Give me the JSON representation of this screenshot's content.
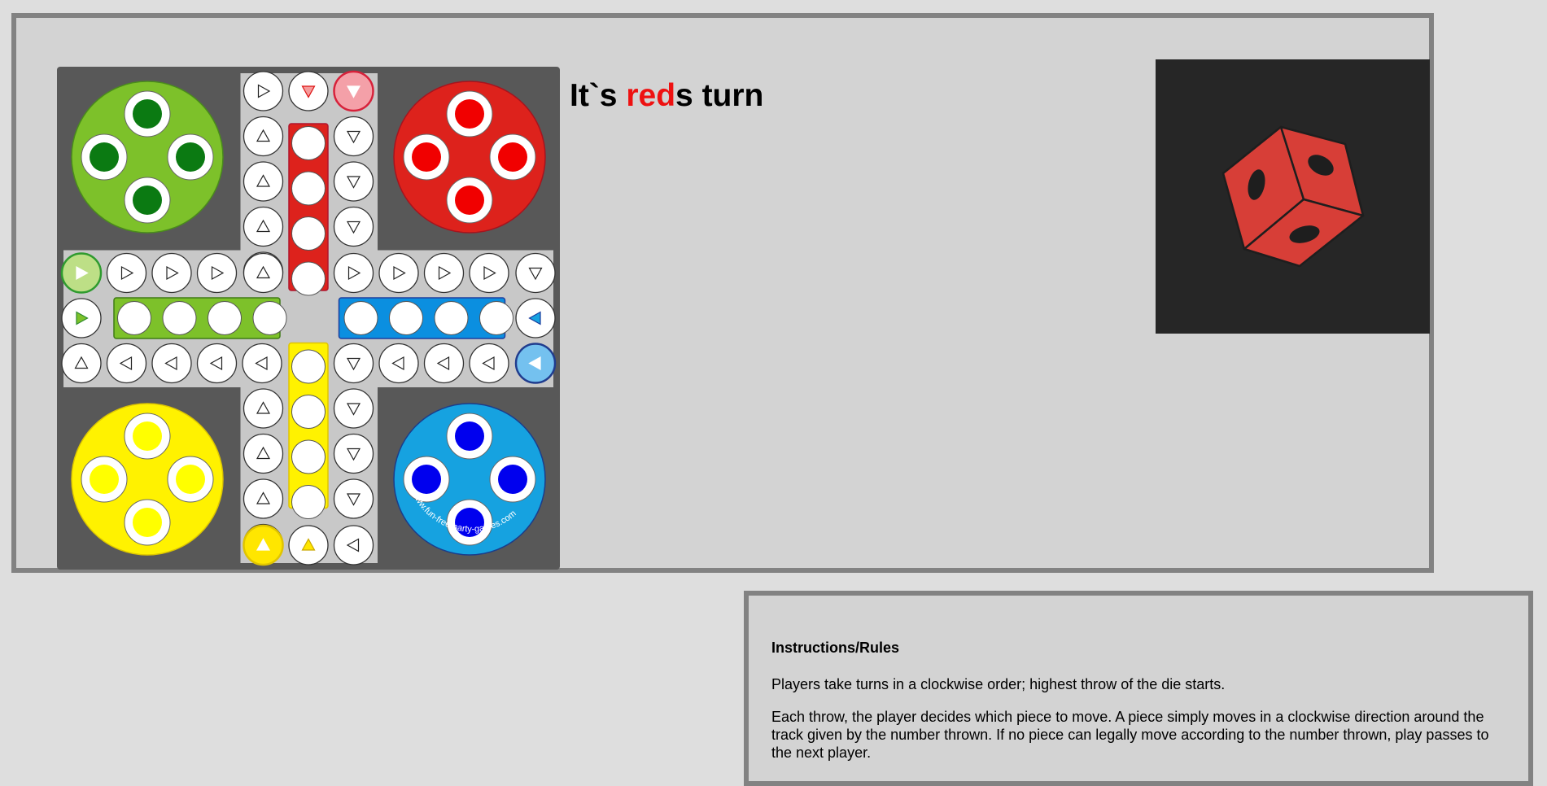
{
  "turn": {
    "prefix": "It`s ",
    "player": "red",
    "suffix": "s turn"
  },
  "board": {
    "watermark": "www.fun-free-party-games.com",
    "colors": {
      "green": "#7dc12a",
      "red": "#dd221c",
      "yellow": "#fff200",
      "blue": "#16a2e0",
      "board": "#585858",
      "track": "#c8c8c8"
    },
    "pieces": {
      "green": "#0b7a12",
      "red": "#f10000",
      "yellow": "#ffff00",
      "blue": "#0000ee"
    }
  },
  "dice": {
    "color": "#d73e37",
    "icon": "die-icon"
  },
  "rules": {
    "title": "Instructions/Rules",
    "paragraphs": [
      "Players take turns in a clockwise order; highest throw of the die starts.",
      "Each throw, the player decides which piece to move. A piece simply moves in a clockwise direction around the track given by the number thrown. If no piece can legally move according to the number thrown, play passes to the next player."
    ]
  }
}
